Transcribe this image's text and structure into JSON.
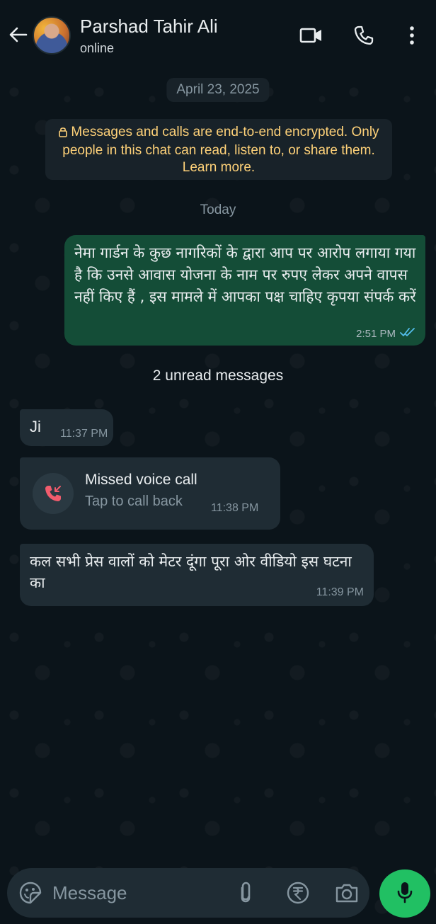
{
  "header": {
    "contact_name": "Parshad Tahir Ali",
    "status": "online",
    "icons": [
      "back-arrow-icon",
      "video-call-icon",
      "voice-call-icon",
      "more-options-icon"
    ]
  },
  "chat": {
    "date_label": "April 23, 2025",
    "encryption_notice": "Messages and calls are end-to-end encrypted. Only people in this chat can read, listen to, or share them. Learn more.",
    "today_label": "Today",
    "unread_label": "2 unread messages",
    "messages": [
      {
        "direction": "outgoing",
        "text": "नेमा गार्डन के कुछ नागरिकों के द्वारा आप पर आरोप लगाया गया है कि उनसे आवास योजना के नाम पर रुपए लेकर अपने वापस नहीं किए हैं , इस मामले में आपका पक्ष चाहिए कृपया संपर्क करें",
        "time": "2:51 PM",
        "status": "read"
      },
      {
        "direction": "incoming",
        "text": "Ji",
        "time": "11:37 PM"
      },
      {
        "direction": "incoming",
        "type": "missed-call",
        "title": "Missed voice call",
        "subtitle": "Tap to call back",
        "time": "11:38 PM"
      },
      {
        "direction": "incoming",
        "text": "कल सभी प्रेस वालों को मेटर दूंगा पूरा ओर वीडियो इस घटना का",
        "time": "11:39 PM"
      }
    ]
  },
  "composer": {
    "placeholder": "Message"
  },
  "colors": {
    "background": "#0b141a",
    "outgoing_bubble": "#144d37",
    "incoming_bubble": "#1f2c34",
    "accent": "#21c063",
    "encryption_text": "#ffd279",
    "read_ticks": "#53bdeb",
    "missed_call": "#f15c6d"
  }
}
